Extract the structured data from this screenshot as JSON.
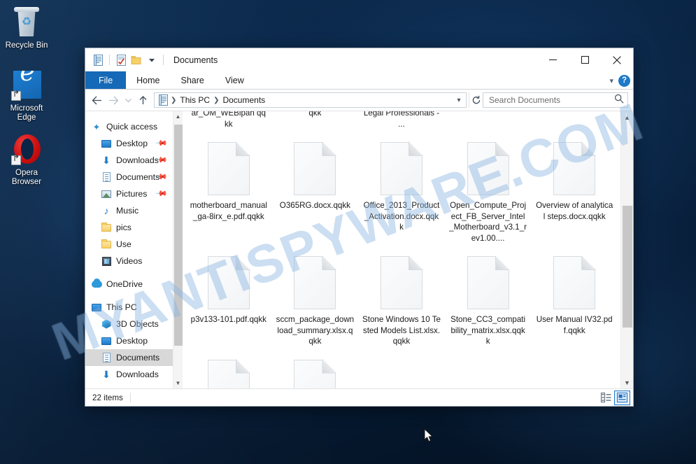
{
  "desktop": {
    "icons": [
      {
        "name": "Recycle Bin",
        "icon": "recycle-bin-icon"
      },
      {
        "name": "Microsoft Edge",
        "icon": "microsoft-edge-icon"
      },
      {
        "name": "Opera Browser",
        "icon": "opera-browser-icon"
      }
    ]
  },
  "watermark": {
    "text": "MYANTISPYWARE.COM",
    "color": "#609cd8"
  },
  "window": {
    "title": "Documents",
    "quick_access_toolbar": [
      {
        "icon": "documents-icon",
        "label": "Documents"
      },
      {
        "icon": "properties-icon",
        "label": "Properties"
      },
      {
        "icon": "new-folder-icon",
        "label": "New folder"
      },
      {
        "icon": "customize-chevron-icon",
        "label": "Customize Quick Access Toolbar"
      }
    ],
    "controls": {
      "minimize": "Minimize",
      "maximize": "Maximize",
      "close": "Close",
      "collapse_ribbon": "Minimize the Ribbon",
      "help": "?"
    },
    "accent_color": "#1669b7"
  },
  "ribbon": {
    "tabs": [
      {
        "label": "File",
        "active": true
      },
      {
        "label": "Home",
        "active": false
      },
      {
        "label": "Share",
        "active": false
      },
      {
        "label": "View",
        "active": false
      }
    ]
  },
  "address_bar": {
    "back": "Back",
    "forward": "Forward",
    "recent": "Recent locations",
    "up": "Up",
    "breadcrumbs": [
      "This PC",
      "Documents"
    ],
    "refresh": "Refresh"
  },
  "search": {
    "placeholder": "Search Documents",
    "value": ""
  },
  "nav_pane": {
    "items": [
      {
        "label": "Quick access",
        "icon": "star-icon",
        "indent": false,
        "pinned": false,
        "selected": false
      },
      {
        "label": "Desktop",
        "icon": "monitor-icon",
        "indent": true,
        "pinned": true,
        "selected": false
      },
      {
        "label": "Downloads",
        "icon": "download-icon",
        "indent": true,
        "pinned": true,
        "selected": false
      },
      {
        "label": "Documents",
        "icon": "document-icon",
        "indent": true,
        "pinned": true,
        "selected": false
      },
      {
        "label": "Pictures",
        "icon": "picture-icon",
        "indent": true,
        "pinned": true,
        "selected": false
      },
      {
        "label": "Music",
        "icon": "music-icon",
        "indent": true,
        "pinned": false,
        "selected": false
      },
      {
        "label": "pics",
        "icon": "folder-icon",
        "indent": true,
        "pinned": false,
        "selected": false
      },
      {
        "label": "Use",
        "icon": "folder-icon",
        "indent": true,
        "pinned": false,
        "selected": false
      },
      {
        "label": "Videos",
        "icon": "video-icon",
        "indent": true,
        "pinned": false,
        "selected": false
      },
      {
        "label": "OneDrive",
        "icon": "cloud-icon",
        "indent": false,
        "pinned": false,
        "selected": false,
        "gap_before": true
      },
      {
        "label": "This PC",
        "icon": "this-pc-icon",
        "indent": false,
        "pinned": false,
        "selected": false,
        "gap_before": true
      },
      {
        "label": "3D Objects",
        "icon": "3d-objects-icon",
        "indent": true,
        "pinned": false,
        "selected": false
      },
      {
        "label": "Desktop",
        "icon": "monitor-icon",
        "indent": true,
        "pinned": false,
        "selected": false
      },
      {
        "label": "Documents",
        "icon": "document-icon",
        "indent": true,
        "pinned": false,
        "selected": true
      },
      {
        "label": "Downloads",
        "icon": "download-icon",
        "indent": true,
        "pinned": false,
        "selected": false
      }
    ]
  },
  "files": [
    {
      "name": "ar_OM_WEBipah qqkk",
      "clipped_top": true
    },
    {
      "name": "qkk",
      "clipped_top": true
    },
    {
      "name": "Legal Professionals - ...",
      "clipped_top": true
    },
    {
      "name": "",
      "clipped_top": true
    },
    {
      "name": "",
      "clipped_top": true
    },
    {
      "name": "motherboard_manual_ga-8irx_e.pdf.qqkk"
    },
    {
      "name": "O365RG.docx.qqkk"
    },
    {
      "name": "Office_2013_Product_Activation.docx.qqkk"
    },
    {
      "name": "Open_Compute_Project_FB_Server_Intel_Motherboard_v3.1_rev1.00...."
    },
    {
      "name": "Overview of analytical steps.docx.qqkk"
    },
    {
      "name": "p3v133-101.pdf.qqkk"
    },
    {
      "name": "sccm_package_download_summary.xlsx.qqkk"
    },
    {
      "name": "Stone Windows 10 Tested Models List.xlsx.qqkk"
    },
    {
      "name": "Stone_CC3_compatibility_matrix.xlsx.qqkk"
    },
    {
      "name": "User Manual IV32.pdf.qqkk"
    },
    {
      "name": "",
      "clipped_bottom": true
    },
    {
      "name": "",
      "clipped_bottom": true
    }
  ],
  "status_bar": {
    "item_count": "22 items",
    "views": [
      {
        "name": "details-view",
        "label": "Details",
        "active": false
      },
      {
        "name": "large-icons-view",
        "label": "Large icons",
        "active": true
      }
    ]
  }
}
